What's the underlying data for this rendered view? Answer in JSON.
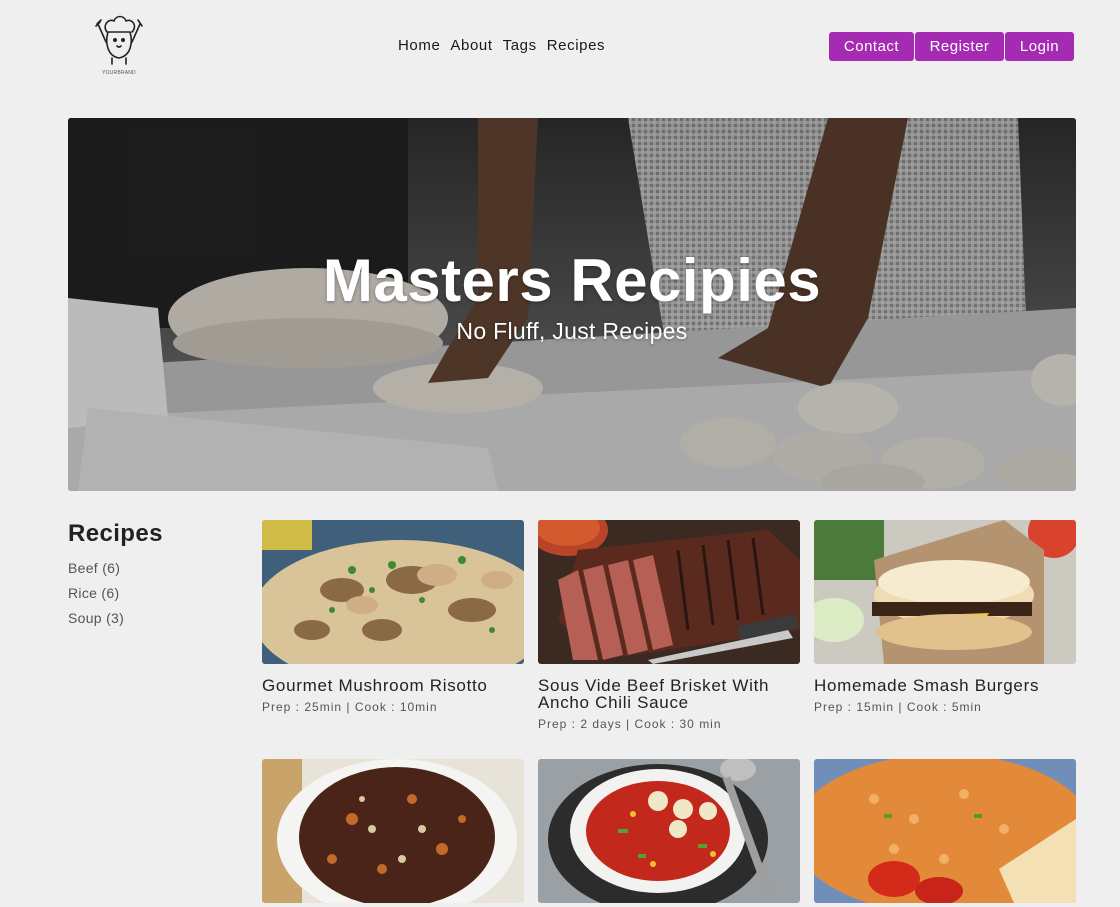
{
  "brand": {
    "logo_text": "YOURBRAND"
  },
  "nav": [
    {
      "label": "Home"
    },
    {
      "label": "About"
    },
    {
      "label": "Tags"
    },
    {
      "label": "Recipes"
    }
  ],
  "auth": {
    "contact": "Contact",
    "register": "Register",
    "login": "Login"
  },
  "colors": {
    "accent": "#a42bb2",
    "background": "#efefef"
  },
  "hero": {
    "title": "Masters Recipies",
    "subtitle": "No Fluff, Just Recipes"
  },
  "sidebar": {
    "title": "Recipes",
    "items": [
      {
        "label": "Beef (6)"
      },
      {
        "label": "Rice (6)"
      },
      {
        "label": "Soup (3)"
      }
    ]
  },
  "recipes": [
    {
      "name": "Gourmet Mushroom Risotto",
      "meta": "Prep : 25min | Cook : 10min"
    },
    {
      "name": "Sous Vide Beef Brisket With Ancho Chili Sauce",
      "meta": "Prep : 2 days | Cook : 30 min"
    },
    {
      "name": "Homemade Smash Burgers",
      "meta": "Prep : 15min | Cook : 5min"
    },
    {
      "name": "",
      "meta": ""
    },
    {
      "name": "",
      "meta": ""
    },
    {
      "name": "",
      "meta": ""
    }
  ]
}
